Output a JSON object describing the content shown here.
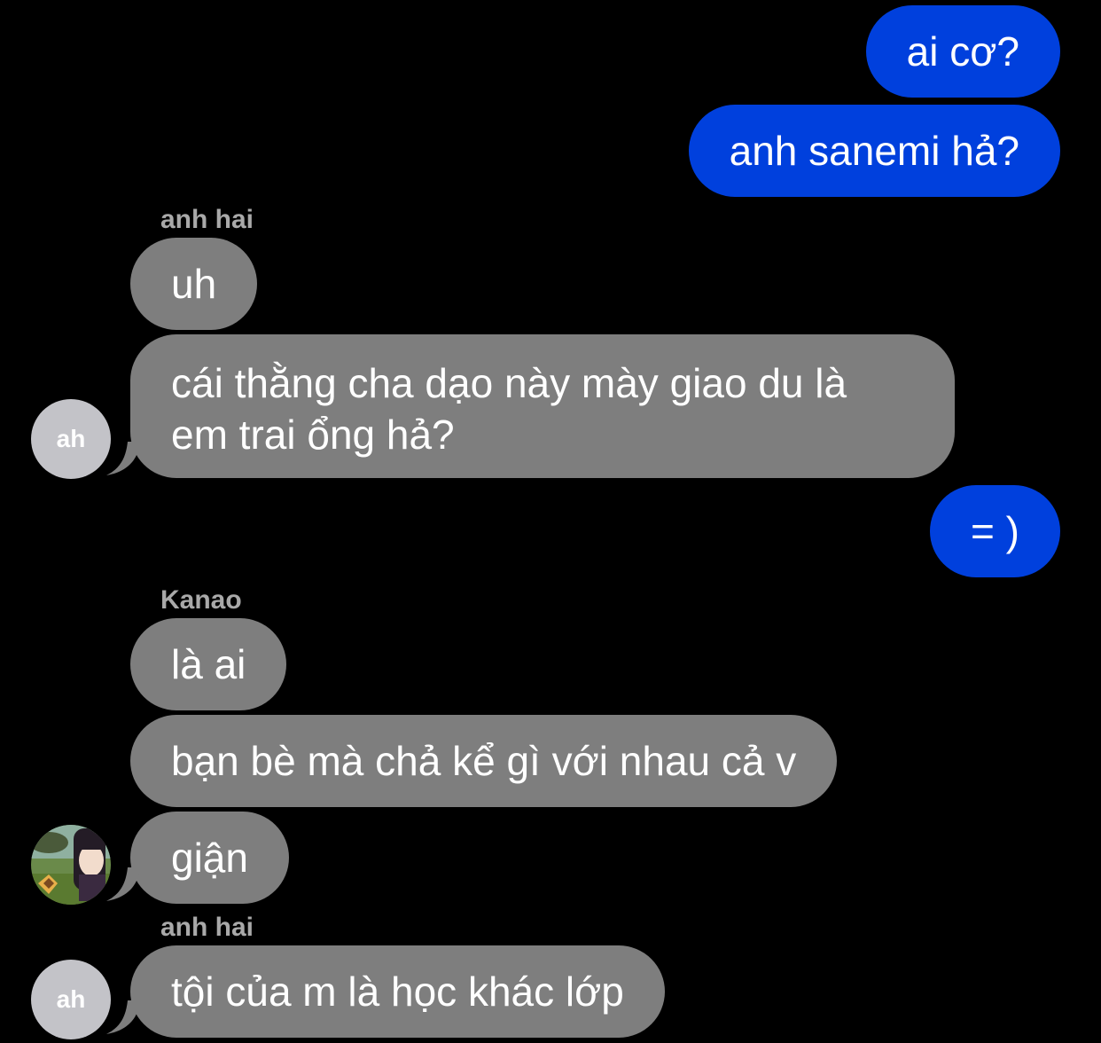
{
  "messages": {
    "m1": "ai cơ?",
    "m2": "anh sanemi hả?",
    "m3": "uh",
    "m4": "cái thằng cha dạo này mày giao du là em trai ổng hả?",
    "m5": "= )",
    "m6": "là ai",
    "m7": "bạn bè mà chả kể gì với nhau cả v",
    "m8": "giận",
    "m9": "tội của m là học khác lớp"
  },
  "senders": {
    "group1": "anh hai",
    "group2": "Kanao",
    "group3": "anh hai"
  },
  "avatars": {
    "anh_hai_initials": "ah",
    "kanao_icon": "kanao-avatar-image"
  },
  "colors": {
    "background": "#000000",
    "sent_bubble": "#0040DD",
    "received_bubble": "#7E7E7E",
    "sender_name": "#A9A9A9",
    "avatar_bg": "#C3C3C8"
  }
}
